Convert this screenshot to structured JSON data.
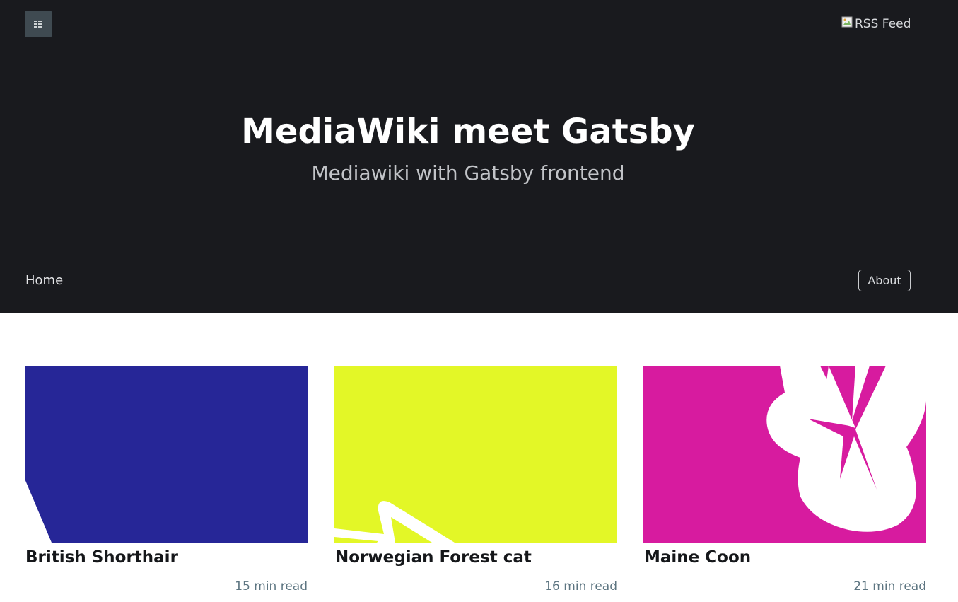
{
  "header": {
    "logo_icon": "site-logo-icon",
    "rss_label": "RSS Feed",
    "rss_icon": "broken-image-icon",
    "title": "MediaWiki meet Gatsby",
    "subtitle": "Mediawiki with Gatsby frontend",
    "nav": {
      "home": "Home",
      "about": "About"
    }
  },
  "colors": {
    "header_bg": "#191a1e",
    "post_1_bg": "#262697",
    "post_2_bg": "#e3f727",
    "post_3_bg": "#d71b9f"
  },
  "posts": [
    {
      "title": "British Shorthair",
      "read_time": "15 min read"
    },
    {
      "title": "Norwegian Forest cat",
      "read_time": "16 min read"
    },
    {
      "title": "Maine Coon",
      "read_time": "21 min read"
    }
  ]
}
